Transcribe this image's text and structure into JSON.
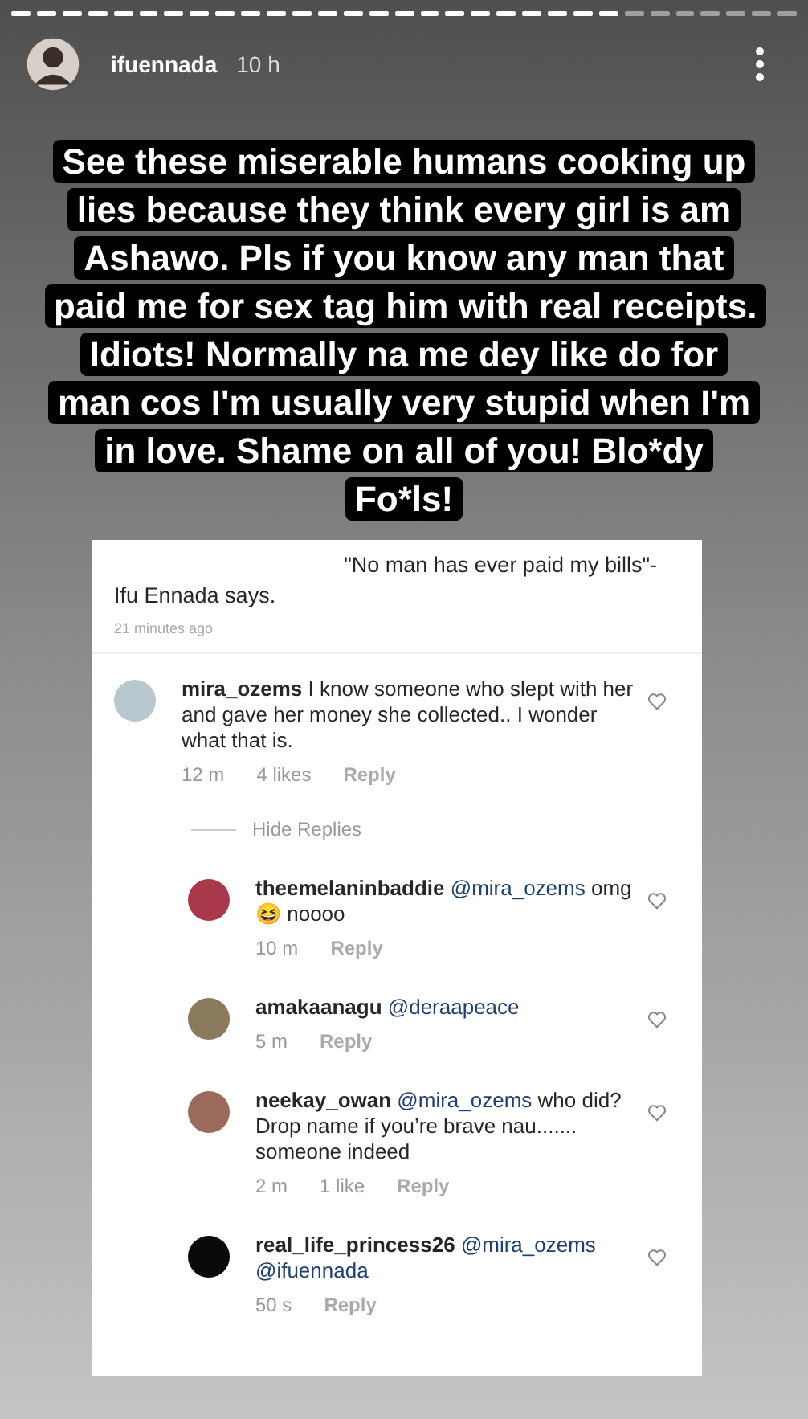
{
  "progress_segments": [
    {
      "seen": true
    },
    {
      "seen": true
    },
    {
      "seen": true
    },
    {
      "seen": true
    },
    {
      "seen": true
    },
    {
      "seen": true
    },
    {
      "seen": true
    },
    {
      "seen": true
    },
    {
      "seen": true
    },
    {
      "seen": true
    },
    {
      "seen": true
    },
    {
      "seen": true
    },
    {
      "seen": true
    },
    {
      "seen": true
    },
    {
      "seen": true
    },
    {
      "seen": true
    },
    {
      "seen": true
    },
    {
      "seen": true
    },
    {
      "seen": true
    },
    {
      "seen": true
    },
    {
      "seen": true
    },
    {
      "seen": true
    },
    {
      "seen": true
    },
    {
      "seen": true
    },
    {
      "seen": false
    },
    {
      "seen": false
    },
    {
      "seen": false
    },
    {
      "seen": false
    },
    {
      "seen": false
    },
    {
      "seen": false
    },
    {
      "seen": false
    }
  ],
  "header": {
    "username": "ifuennada",
    "time": "10 h"
  },
  "caption": "See these miserable humans cooking up lies because they think every girl is am Ashawo. Pls if you know any man that paid me for sex tag him with real receipts. Idiots! Normally na me dey like do for man cos I'm usually very stupid when I'm in love. Shame on all of you! Blo*dy Fo*ls!",
  "post": {
    "quote": "\"No man has ever paid my bills\"-",
    "author_line": "Ifu Ennada says.",
    "time": "21 minutes ago"
  },
  "comment": {
    "username": "mira_ozems",
    "text": "I know someone who slept with her and gave her money she collected.. I wonder what that is.",
    "color": "#b9c7cf",
    "time": "12 m",
    "likes": "4 likes",
    "reply": "Reply"
  },
  "hide_replies": "Hide Replies",
  "replies": [
    {
      "username": "theemelaninbaddie",
      "mention": "@mira_ozems",
      "text": "omg 😆 noooo",
      "color": "#a8384a",
      "time": "10 m",
      "reply": "Reply"
    },
    {
      "username": "amakaanagu",
      "mention": "@deraapeace",
      "color": "#8a7a5e",
      "time": "5 m",
      "reply": "Reply"
    },
    {
      "username": "neekay_owan",
      "mention": "@mira_ozems",
      "text": "who did? Drop name if you’re brave nau....... someone indeed",
      "color": "#9a6a5a",
      "time": "2 m",
      "likes": "1 like",
      "reply": "Reply"
    },
    {
      "username": "real_life_princess26",
      "mention": "@mira_ozems @ifuennada",
      "color": "#0a0a0a",
      "time": "50 s",
      "reply": "Reply"
    }
  ]
}
